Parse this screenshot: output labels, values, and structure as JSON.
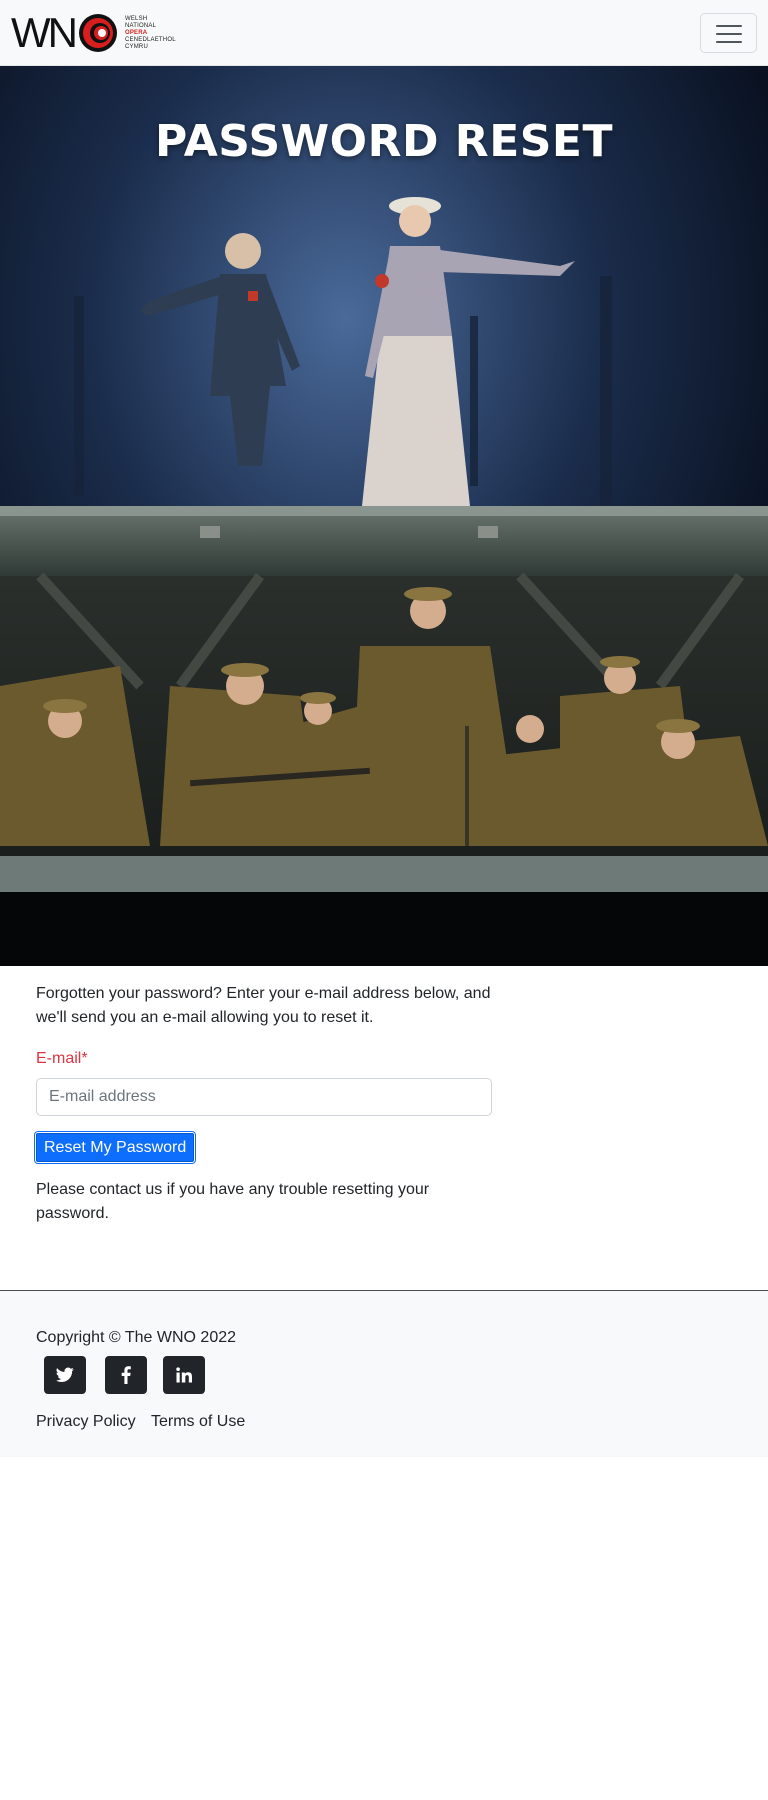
{
  "brand": {
    "logo_letters": "WN",
    "logo_lines": [
      "WELSH",
      "NATIONAL",
      "OPERA",
      "CENEDLAETHOL",
      "CYMRU"
    ],
    "accent_color": "#d81e1e"
  },
  "navbar": {
    "menu_icon": "hamburger-icon"
  },
  "hero": {
    "title": "PASSWORD RESET"
  },
  "form": {
    "intro": "Forgotten your password? Enter your e-mail address below, and we'll send you an e-mail allowing you to reset it.",
    "email_label": "E-mail",
    "required_marker": "*",
    "email_placeholder": "E-mail address",
    "email_value": "",
    "submit_label": "Reset My Password",
    "contact_note": "Please contact us if you have any trouble resetting your password."
  },
  "footer": {
    "copyright": "Copyright © The WNO 2022",
    "social": [
      {
        "icon": "twitter-icon"
      },
      {
        "icon": "facebook-icon"
      },
      {
        "icon": "linkedin-icon"
      }
    ],
    "links": [
      "Privacy Policy",
      "Terms of Use"
    ]
  }
}
